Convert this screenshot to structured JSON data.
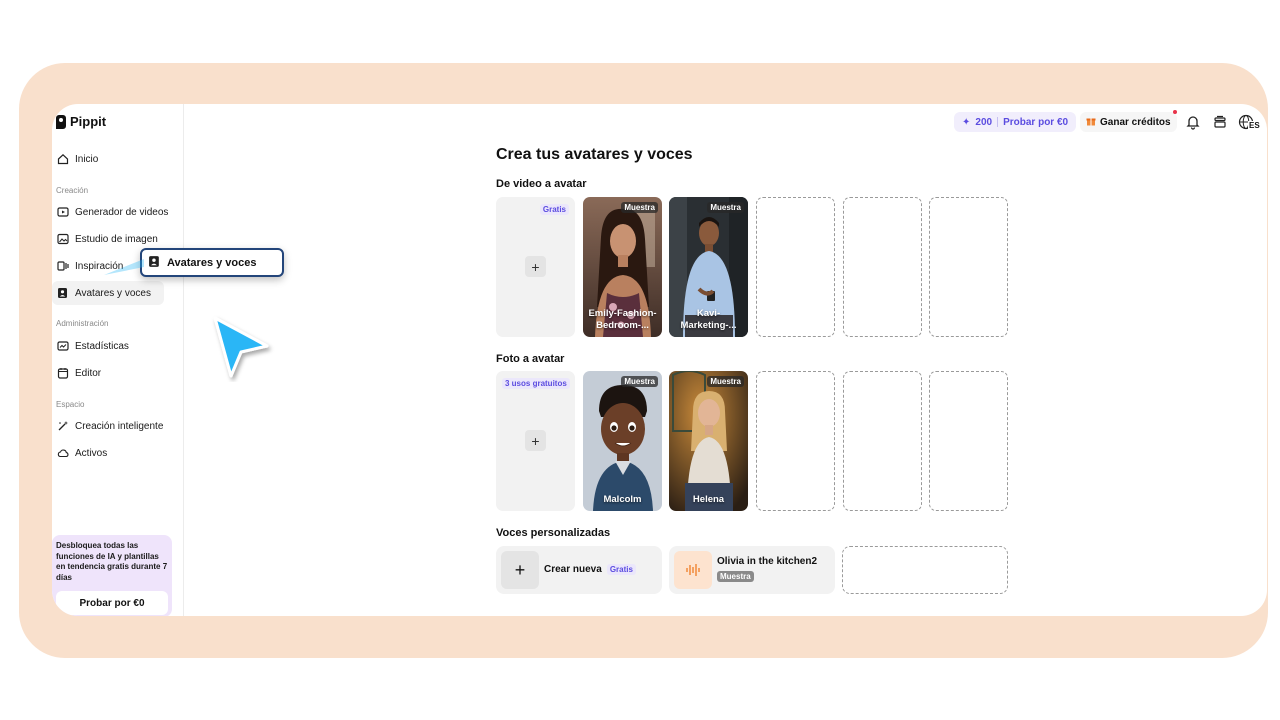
{
  "logo": {
    "name": "Pippit"
  },
  "sidebar": {
    "home": "Inicio",
    "section_creation": "Creación",
    "creation_items": [
      "Generador de videos",
      "Estudio de imagen",
      "Inspiración",
      "Avatares y voces"
    ],
    "section_admin": "Administración",
    "admin_items": [
      "Estadísticas",
      "Editor"
    ],
    "section_space": "Espacio",
    "space_items": [
      "Creación inteligente",
      "Activos"
    ],
    "promo": {
      "text": "Desbloquea todas las funciones de IA y plantillas en tendencia gratis durante 7 días",
      "button": "Probar por €0"
    }
  },
  "header": {
    "credits": "200",
    "try_label": "Probar por €0",
    "earn_label": "Ganar créditos",
    "language": "ES"
  },
  "main": {
    "title": "Crea tus avatares y voces",
    "video_section": {
      "label": "De video a avatar",
      "add_tag": "Gratis",
      "samples": [
        {
          "tag": "Muestra",
          "name": "Emily-Fashion-Bedroom-..."
        },
        {
          "tag": "Muestra",
          "name": "Kavi-Marketing-..."
        }
      ]
    },
    "photo_section": {
      "label": "Foto a avatar",
      "add_tag": "3 usos gratuitos",
      "samples": [
        {
          "tag": "Muestra",
          "name": "Malcolm"
        },
        {
          "tag": "Muestra",
          "name": "Helena"
        }
      ]
    },
    "voice_section": {
      "label": "Voces personalizadas",
      "create_label": "Crear nueva",
      "create_tag": "Gratis",
      "sample_name": "Olivia in the kitchen2",
      "sample_tag": "Muestra"
    }
  },
  "tooltip": {
    "label": "Avatares y voces"
  },
  "colors": {
    "accent": "#5b4ce0",
    "frame": "#f9e0cc",
    "cursor": "#29b6f6"
  }
}
